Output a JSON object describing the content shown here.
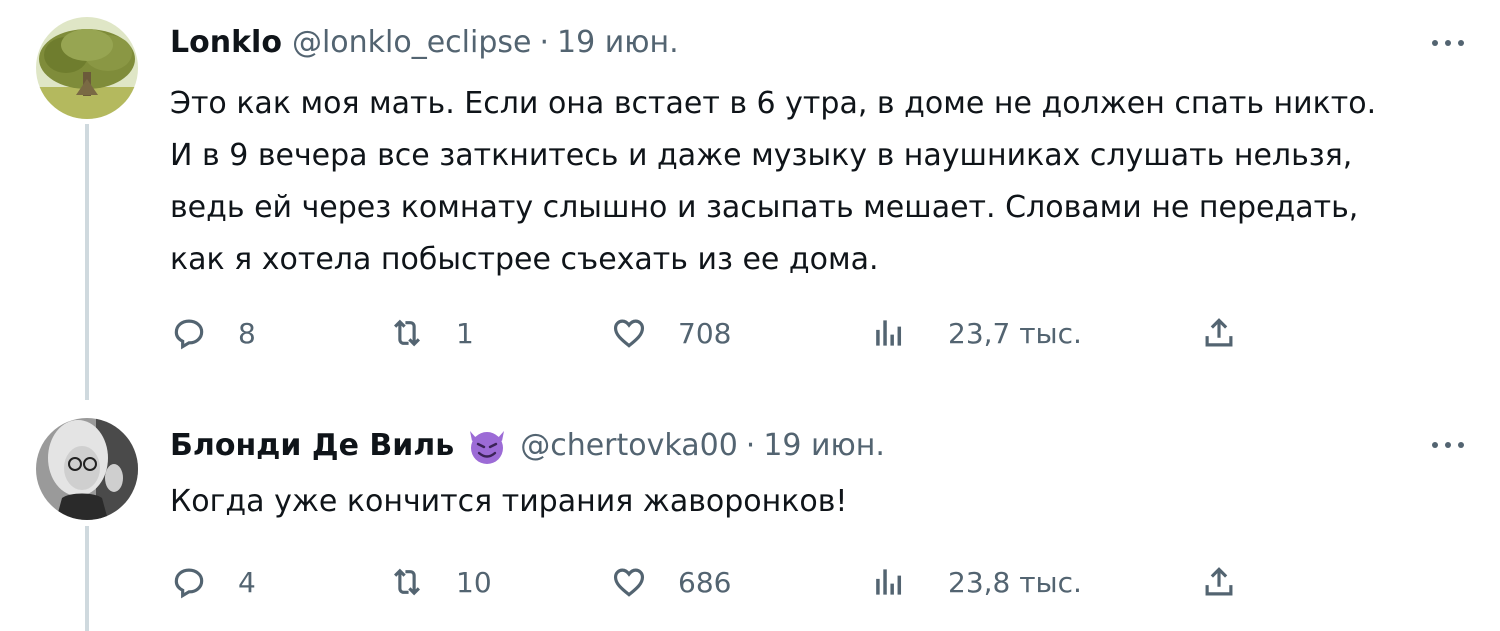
{
  "tweets": [
    {
      "author_name": "Lonklo",
      "handle": "@lonklo_eclipse",
      "separator": "·",
      "date": "19 июн.",
      "text_lines": [
        "Это как моя мать. Если она встает в 6 утра, в доме не должен спать никто.",
        "И в 9 вечера все заткнитесь и даже музыку в наушниках слушать нельзя,",
        "ведь ей через комнату слышно и засыпать мешает. Словами не передать,",
        "как я хотела побыстрее съехать из ее дома."
      ],
      "replies": "8",
      "retweets": "1",
      "likes": "708",
      "views": "23,7 тыс.",
      "avatar": "tree-photo"
    },
    {
      "author_name": "Блонди Де Виль",
      "badge": "smiling-devil-emoji",
      "handle": "@chertovka00",
      "separator": "·",
      "date": "19 июн.",
      "text_lines": [
        "Когда уже кончится тирания жаворонков!"
      ],
      "replies": "4",
      "retweets": "10",
      "likes": "686",
      "views": "23,8 тыс.",
      "avatar": "woman-glasses-photo"
    }
  ],
  "colors": {
    "text": "#0f1419",
    "secondary": "#536471",
    "thread_line": "#cfd9de",
    "badge": "#9c6bd6"
  }
}
